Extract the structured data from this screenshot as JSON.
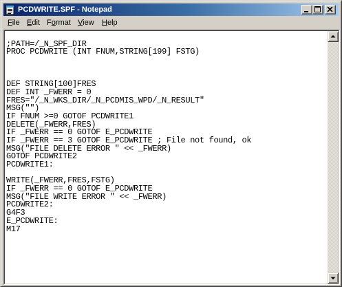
{
  "window": {
    "title": "PCDWRITE.SPF - Notepad"
  },
  "menu": {
    "file": {
      "accel": "F",
      "rest": "ile"
    },
    "edit": {
      "accel": "E",
      "rest": "dit"
    },
    "format": {
      "accel": "o",
      "pre": "F",
      "rest": "rmat"
    },
    "view": {
      "accel": "V",
      "rest": "iew"
    },
    "help": {
      "accel": "H",
      "rest": "elp"
    }
  },
  "document": {
    "lines": [
      "",
      ";PATH=/_N_SPF_DIR",
      "PROC PCDWRITE (INT FNUM,STRING[199] FSTG)",
      "",
      "",
      "",
      "DEF STRING[100]FRES",
      "DEF INT _FWERR = 0",
      "FRES=\"/_N_WKS_DIR/_N_PCDMIS_WPD/_N_RESULT\"",
      "MSG(\"\")",
      "IF FNUM >=0 GOTOF PCDWRITE1",
      "DELETE(_FWERR,FRES)",
      "IF _FWERR == 0 GOTOF E_PCDWRITE",
      "IF _FWERR == 3 GOTOF E_PCDWRITE ; File not found, ok",
      "MSG(\"FILE DELETE ERROR \" << _FWERR)",
      "GOTOF PCDWRITE2",
      "PCDWRITE1:",
      "",
      "WRITE(_FWERR,FRES,FSTG)",
      "IF _FWERR == 0 GOTOF E_PCDWRITE",
      "MSG(\"FILE WRITE ERROR \" << _FWERR)",
      "PCDWRITE2:",
      "G4F3",
      "E_PCDWRITE:",
      "M17"
    ]
  },
  "icons": {
    "app": "notepad-icon",
    "minimize": "minimize-icon",
    "maximize": "maximize-icon",
    "close": "close-icon",
    "scroll_up": "arrow-up-icon",
    "scroll_down": "arrow-down-icon"
  },
  "colors": {
    "title_active_start": "#0a246a",
    "title_active_end": "#a6caf0",
    "window_face": "#d4d0c8",
    "editor_background": "#ffffff"
  }
}
